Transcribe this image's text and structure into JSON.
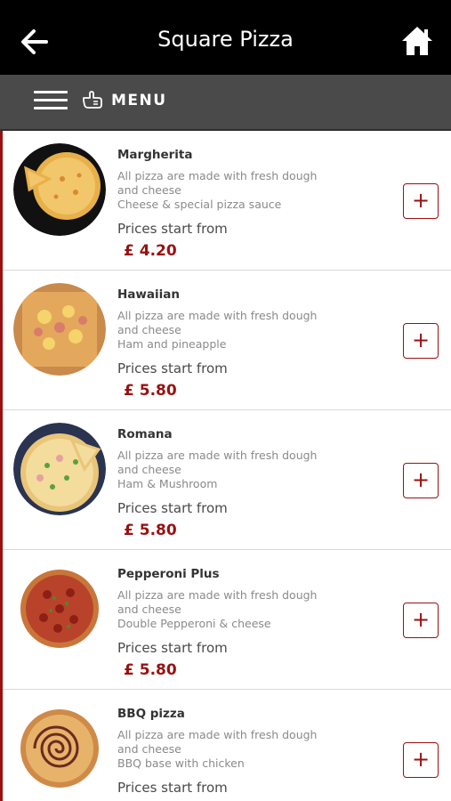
{
  "header": {
    "title": "Square Pizza",
    "back_icon": "arrow-left-icon",
    "home_icon": "home-icon"
  },
  "menubar": {
    "label": "MENU",
    "hamburger_icon": "hamburger-icon",
    "hand_icon": "pointing-hand-icon"
  },
  "colors": {
    "topbar": "#000000",
    "menubar": "#4a4a4a",
    "accent": "#9a1010"
  },
  "items": [
    {
      "name": "Margherita",
      "desc": "All pizza are made with fresh dough and cheese",
      "detail": "Cheese & special pizza sauce",
      "from": "Prices start from",
      "price": "£ 4.20",
      "add": "+"
    },
    {
      "name": "Hawaiian",
      "desc": "All pizza are made with fresh dough and cheese",
      "detail": "Ham and pineapple",
      "from": "Prices start from",
      "price": "£ 5.80",
      "add": "+"
    },
    {
      "name": "Romana",
      "desc": "All pizza are made with fresh dough and cheese",
      "detail": "Ham & Mushroom",
      "from": "Prices start from",
      "price": "£ 5.80",
      "add": "+"
    },
    {
      "name": "Pepperoni Plus",
      "desc": "All pizza are made with fresh dough and cheese",
      "detail": "Double Pepperoni & cheese",
      "from": "Prices start from",
      "price": "£ 5.80",
      "add": "+"
    },
    {
      "name": "BBQ pizza",
      "desc": "All pizza are made with fresh dough and cheese",
      "detail": "BBQ base with chicken",
      "from": "Prices start from",
      "price": "",
      "add": "+"
    }
  ]
}
